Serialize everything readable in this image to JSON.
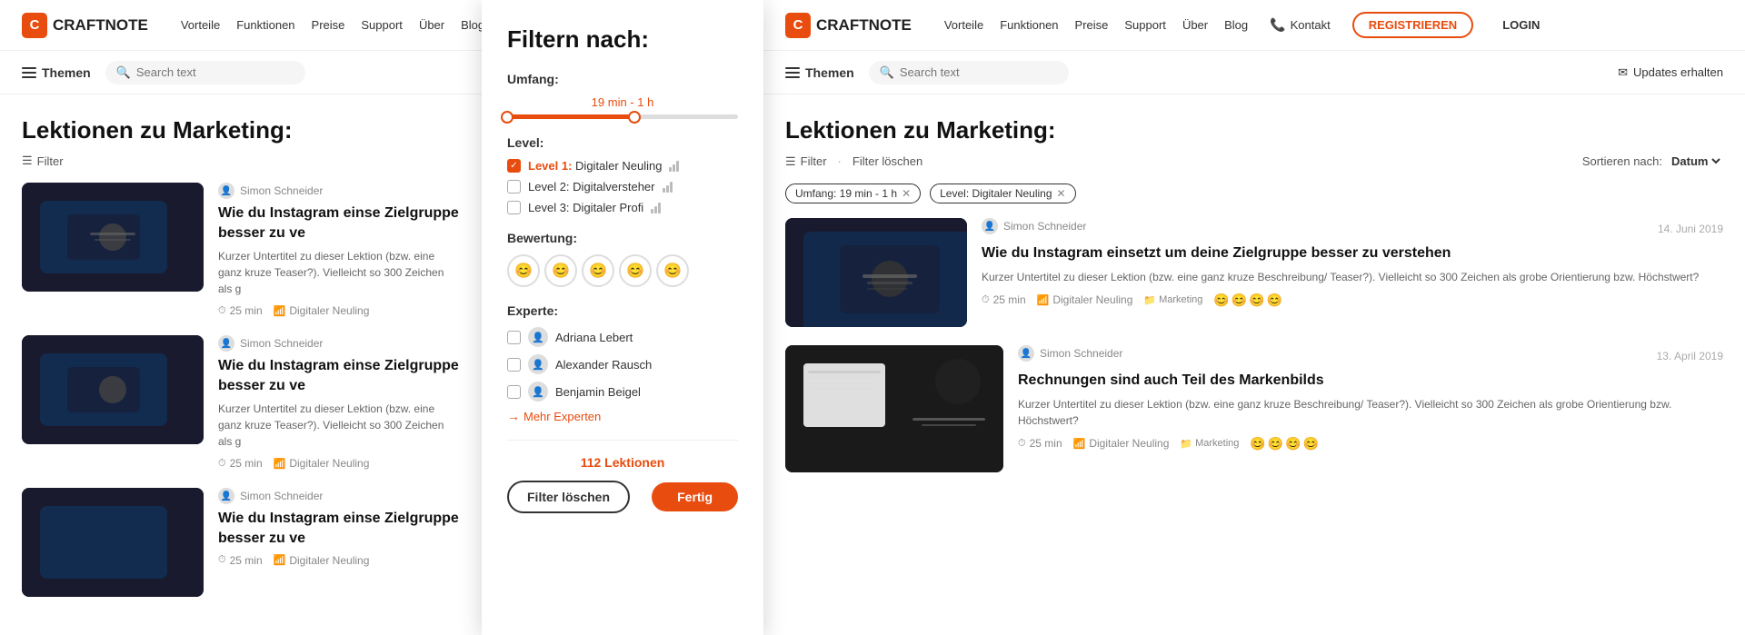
{
  "brand": {
    "name": "CRAFTNOTE",
    "logo_letter": "C"
  },
  "nav": {
    "links": [
      "Vorteile",
      "Funktionen",
      "Preise",
      "Support",
      "Über",
      "Blog"
    ],
    "phone_label": "Kontakt",
    "register_label": "REGISTRIEREN",
    "login_label": "LOGIN"
  },
  "toolbar": {
    "themen_label": "Themen",
    "search_placeholder": "Search text",
    "updates_label": "Updates erhalten"
  },
  "page_left": {
    "title": "Lektionen zu Marketing:",
    "filter_label": "Filter",
    "lessons": [
      {
        "author": "Simon Schneider",
        "title": "Wie du Instagram einse Zielgruppe besser zu ve",
        "desc": "Kurzer Untertitel zu dieser Lektion (bzw. eine ganz kruze Teaser?). Vielleicht so 300 Zeichen als g",
        "duration": "25 min",
        "level": "Digitaler Neuling"
      },
      {
        "author": "Simon Schneider",
        "title": "Wie du Instagram einse Zielgruppe besser zu ve",
        "desc": "Kurzer Untertitel zu dieser Lektion (bzw. eine ganz kruze Teaser?). Vielleicht so 300 Zeichen als g",
        "duration": "25 min",
        "level": "Digitaler Neuling"
      },
      {
        "author": "Simon Schneider",
        "title": "Wie du Instagram einse Zielgruppe besser zu ve",
        "desc": "",
        "duration": "25 min",
        "level": "Digitaler Neuling"
      }
    ]
  },
  "filter_panel": {
    "title": "Filtern nach:",
    "umfang_label": "Umfang:",
    "umfang_value": "19 min - 1 h",
    "level_label": "Level:",
    "levels": [
      {
        "label": "Level 1:",
        "name": "Digitaler Neuling",
        "checked": true
      },
      {
        "label": "Level 2:",
        "name": "Digitalversteher",
        "checked": false
      },
      {
        "label": "Level 3:",
        "name": "Digitaler Profi",
        "checked": false
      }
    ],
    "bewertung_label": "Bewertung:",
    "experte_label": "Experte:",
    "experts": [
      {
        "name": "Adriana Lebert"
      },
      {
        "name": "Alexander Rausch"
      },
      {
        "name": "Benjamin Beigel"
      }
    ],
    "more_experts_label": "Mehr Experten",
    "count_label": "112 Lektionen",
    "clear_label": "Filter löschen",
    "done_label": "Fertig"
  },
  "page_right": {
    "title": "Lektionen zu Marketing:",
    "filter_label": "Filter",
    "filter_loeschen_label": "Filter löschen",
    "sort_label": "Sortieren nach:",
    "sort_value": "Datum",
    "active_filters": [
      {
        "label": "Umfang: 19 min - 1 h"
      },
      {
        "label": "Level: Digitaler Neuling"
      }
    ],
    "lessons": [
      {
        "author": "Simon Schneider",
        "date": "14. Juni 2019",
        "title": "Wie du Instagram einsetzt um deine Zielgruppe besser zu verstehen",
        "desc": "Kurzer Untertitel zu dieser Lektion (bzw. eine ganz kruze Beschreibung/ Teaser?). Vielleicht so 300 Zeichen als grobe Orientierung bzw. Höchstwert?",
        "duration": "25 min",
        "level": "Digitaler Neuling",
        "category": "Marketing",
        "thumb_style": "dark"
      },
      {
        "author": "Simon Schneider",
        "date": "13. April 2019",
        "title": "Rechnungen sind auch Teil des Markenbilds",
        "desc": "Kurzer Untertitel zu dieser Lektion (bzw. eine ganz kruze Beschreibung/ Teaser?). Vielleicht so 300 Zeichen als grobe Orientierung bzw. Höchstwert?",
        "duration": "25 min",
        "level": "Digitaler Neuling",
        "category": "Marketing",
        "thumb_style": "light"
      }
    ]
  }
}
